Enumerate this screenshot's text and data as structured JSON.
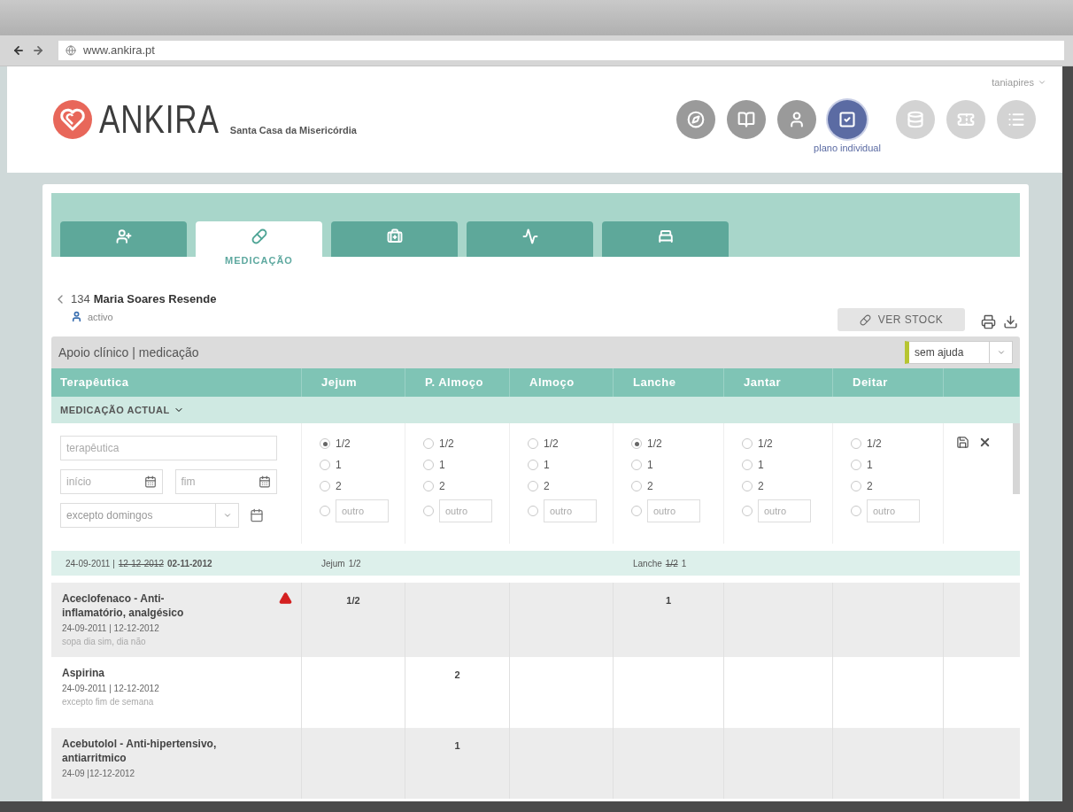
{
  "browser": {
    "url": "www.ankira.pt"
  },
  "header": {
    "logo": "ANKIRA",
    "subtitle": "Santa Casa da Misericórdia",
    "user": "taniapires",
    "nav": [
      {
        "kind": "compass",
        "selected": false,
        "disabled": false
      },
      {
        "kind": "book",
        "selected": false,
        "disabled": false
      },
      {
        "kind": "person",
        "selected": false,
        "disabled": false
      },
      {
        "kind": "checkbox",
        "selected": true,
        "disabled": false,
        "label": "plano individual"
      },
      {
        "kind": "database",
        "selected": false,
        "disabled": true
      },
      {
        "kind": "ticket",
        "selected": false,
        "disabled": true
      },
      {
        "kind": "list",
        "selected": false,
        "disabled": true
      }
    ]
  },
  "tabs": [
    {
      "kind": "patient",
      "selected": false
    },
    {
      "kind": "pills",
      "selected": true,
      "label": "MEDICAÇÃO"
    },
    {
      "kind": "kit",
      "selected": false
    },
    {
      "kind": "pulse",
      "selected": false
    },
    {
      "kind": "bed",
      "selected": false
    }
  ],
  "patient": {
    "number": "134",
    "name": "Maria Soares Resende",
    "status": "activo"
  },
  "actions": {
    "stock_button": "VER STOCK"
  },
  "toolbar": {
    "title": "Apoio clínico | medicação",
    "help_select": "sem ajuda"
  },
  "table": {
    "columns": [
      "Terapêutica",
      "Jejum",
      "P. Almoço",
      "Almoço",
      "Lanche",
      "Jantar",
      "Deitar"
    ],
    "section": "MEDICAÇÃO ACTUAL",
    "form": {
      "name_placeholder": "terapêutica",
      "start_placeholder": "início",
      "end_placeholder": "fim",
      "repeat_value": "excepto domingos",
      "meals": [
        {
          "options": [
            {
              "label": "1/2",
              "selected": true
            },
            {
              "label": "1",
              "selected": false
            },
            {
              "label": "2",
              "selected": false
            }
          ],
          "other_selected": false,
          "other_placeholder": "outro"
        },
        {
          "options": [
            {
              "label": "1/2",
              "selected": false
            },
            {
              "label": "1",
              "selected": false
            },
            {
              "label": "2",
              "selected": false
            }
          ],
          "other_selected": false,
          "other_placeholder": "outro"
        },
        {
          "options": [
            {
              "label": "1/2",
              "selected": false
            },
            {
              "label": "1",
              "selected": false
            },
            {
              "label": "2",
              "selected": false
            }
          ],
          "other_selected": false,
          "other_placeholder": "outro"
        },
        {
          "options": [
            {
              "label": "1/2",
              "selected": true
            },
            {
              "label": "1",
              "selected": false
            },
            {
              "label": "2",
              "selected": false
            }
          ],
          "other_selected": false,
          "other_placeholder": "outro"
        },
        {
          "options": [
            {
              "label": "1/2",
              "selected": false
            },
            {
              "label": "1",
              "selected": false
            },
            {
              "label": "2",
              "selected": false
            }
          ],
          "other_selected": false,
          "other_placeholder": "outro"
        },
        {
          "options": [
            {
              "label": "1/2",
              "selected": false
            },
            {
              "label": "1",
              "selected": false
            },
            {
              "label": "2",
              "selected": false
            }
          ],
          "other_selected": false,
          "other_placeholder": "outro"
        }
      ]
    },
    "summary": {
      "start": "24-09-2011 |",
      "old_end": "12-12-2012",
      "new_end": "02-11-2012",
      "slots": [
        {
          "kind": "entry",
          "label": "Jejum",
          "value": "1/2"
        },
        {
          "kind": "empty"
        },
        {
          "kind": "empty"
        },
        {
          "kind": "entry",
          "label": "Lanche",
          "old": "1/2",
          "value": "1"
        },
        {
          "kind": "empty"
        },
        {
          "kind": "empty"
        }
      ]
    },
    "rows": [
      {
        "name": "Aceclofenaco - Anti-inflamatório, analgésico",
        "dates": "24-09-2011 | 12-12-2012",
        "note": "sopa dia sim, dia não",
        "warning": true,
        "doses": [
          {
            "kind": "dose",
            "value": "1/2"
          },
          {
            "kind": "empty"
          },
          {
            "kind": "empty"
          },
          {
            "kind": "dose",
            "value": "1"
          },
          {
            "kind": "empty"
          },
          {
            "kind": "empty"
          }
        ]
      },
      {
        "name": "Aspirina",
        "dates": "24-09-2011 | 12-12-2012",
        "note": "excepto fim de semana",
        "doses": [
          {
            "kind": "empty"
          },
          {
            "kind": "dose",
            "value": "2"
          },
          {
            "kind": "empty"
          },
          {
            "kind": "empty"
          },
          {
            "kind": "empty"
          },
          {
            "kind": "empty"
          }
        ]
      },
      {
        "name": "Acebutolol - Anti-hipertensivo, antiarritmico",
        "dates": "24-09 |12-12-2012",
        "doses": [
          {
            "kind": "empty"
          },
          {
            "kind": "dose",
            "value": "1"
          },
          {
            "kind": "empty"
          },
          {
            "kind": "empty"
          },
          {
            "kind": "empty"
          },
          {
            "kind": "empty"
          }
        ]
      }
    ]
  }
}
